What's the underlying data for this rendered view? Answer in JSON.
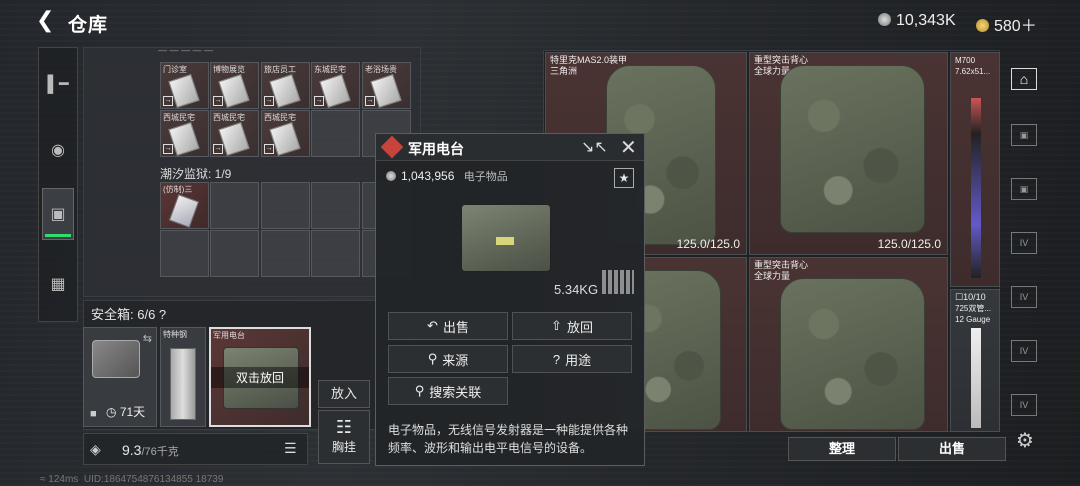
{
  "header": {
    "title": "仓库",
    "currency1": "10,343K",
    "currency2": "580＋"
  },
  "storage": {
    "top_items": [
      "门诊室",
      "博物展览",
      "旅店员工",
      "东城民宅",
      "老浴场贵"
    ],
    "row2_items": [
      "西城民宅",
      "西城民宅",
      "西城民宅"
    ],
    "tide_prison_label": "潮汐监狱: 1/9",
    "tide_item": "(仿制)三"
  },
  "safebox": {
    "label": "安全箱: 6/6",
    "help": "?",
    "timer": "71天",
    "item1": "特种钢",
    "item2": "军用电台",
    "double_click_hint": "双击放回",
    "put_in": "放入",
    "vest_label": "胸挂"
  },
  "weight": {
    "value": "9.3",
    "max": "/76千克"
  },
  "popup": {
    "title": "军用电台",
    "price": "1,043,956",
    "category": "电子物品",
    "weight": "5.34KG",
    "buttons": {
      "sell": "出售",
      "return": "放回",
      "source": "来源",
      "use": "用途",
      "search": "搜索关联"
    },
    "description": "电子物品，无线信号发射器是一种能提供各种频率、波形和输出电平电信号的设备。"
  },
  "gear": {
    "cell1": {
      "name": "特里克MAS2.0装甲",
      "sub": "三角洲"
    },
    "cell2": {
      "name": "重型突击背心",
      "sub": "全球力量",
      "durability": "125.0/125.0"
    },
    "cell3": {
      "name": "M700",
      "sub": "7.62x51..."
    },
    "cell1_dura": "125.0/125.0",
    "cell4": {
      "name": "重型突击背心",
      "sub": "全球力量"
    },
    "cell5": {
      "ammo": "10/10",
      "name": "725双管...",
      "sub": "12 Gauge"
    }
  },
  "bottom_buttons": {
    "organize": "整理",
    "sell": "出售"
  },
  "status": {
    "ping": "124ms",
    "uid": "UID:1864754876134855 18739"
  },
  "colors": {
    "active_green": "#2ee06b",
    "item_red": "#4a3333",
    "popup_icon_red": "#c8433b"
  }
}
